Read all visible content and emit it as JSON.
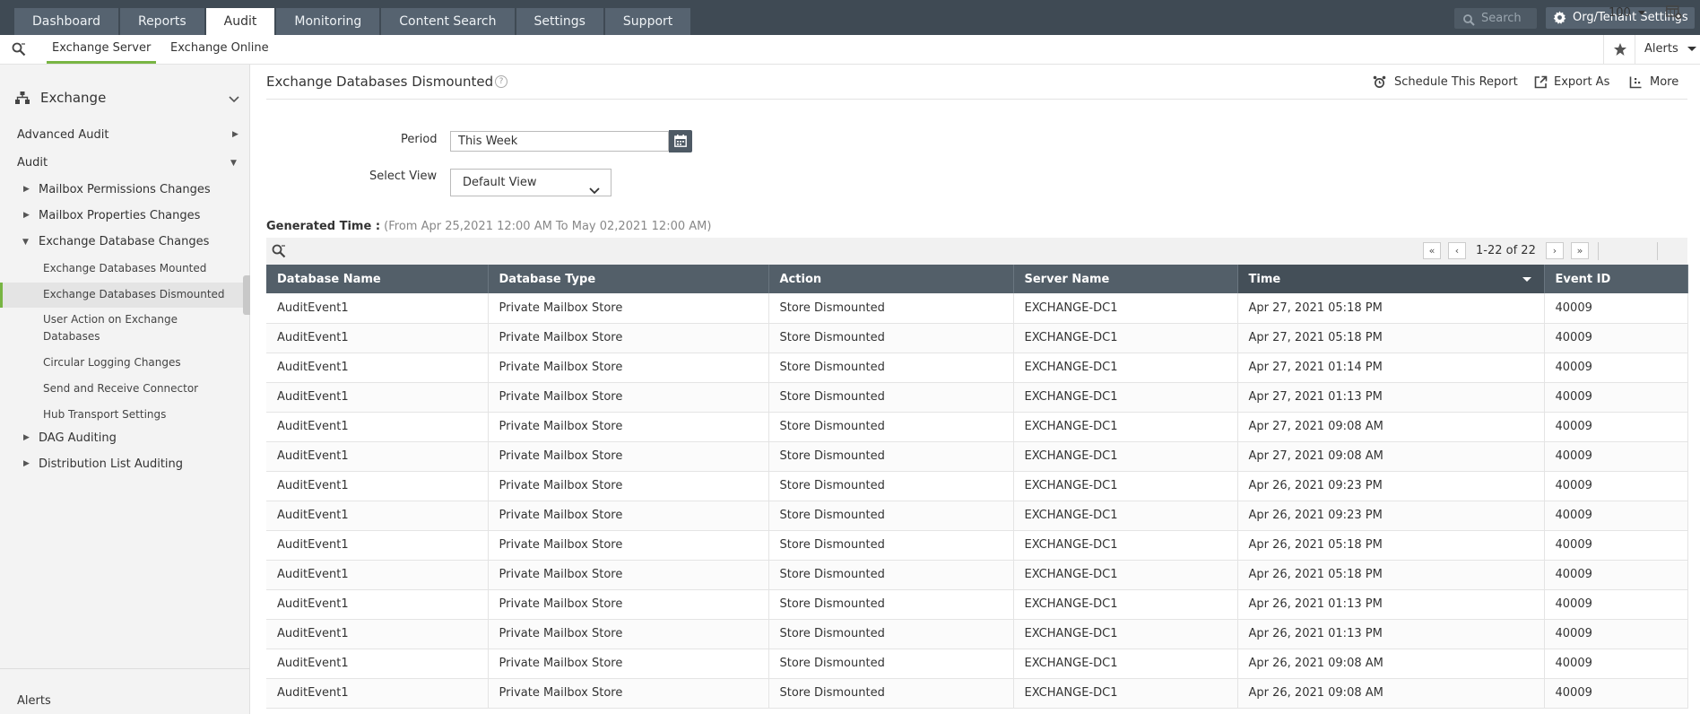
{
  "top_nav": {
    "tabs": [
      {
        "label": "Dashboard"
      },
      {
        "label": "Reports"
      },
      {
        "label": "Audit",
        "active": true
      },
      {
        "label": "Monitoring"
      },
      {
        "label": "Content Search"
      },
      {
        "label": "Settings"
      },
      {
        "label": "Support"
      }
    ],
    "search_placeholder": "Search",
    "org_settings_label": "Org/Tenant Settings"
  },
  "sub_nav": {
    "tabs": [
      {
        "label": "Exchange Server",
        "active": true
      },
      {
        "label": "Exchange Online"
      }
    ],
    "alerts_label": "Alerts"
  },
  "sidebar": {
    "header": "Exchange",
    "sections": [
      {
        "label": "Advanced Audit"
      },
      {
        "label": "Audit"
      }
    ],
    "groups": [
      {
        "label": "Mailbox Permissions Changes"
      },
      {
        "label": "Mailbox Properties Changes"
      },
      {
        "label": "Exchange Database Changes"
      }
    ],
    "sub_items": [
      {
        "label": "Exchange Databases Mounted"
      },
      {
        "label": "Exchange Databases Dismounted",
        "active": true
      },
      {
        "label": "User Action on Exchange Databases"
      },
      {
        "label": "Circular Logging Changes"
      },
      {
        "label": "Send and Receive Connector"
      },
      {
        "label": "Hub Transport Settings"
      }
    ],
    "more_groups": [
      {
        "label": "DAG Auditing"
      },
      {
        "label": "Distribution List Auditing"
      }
    ],
    "bottom_label": "Alerts"
  },
  "report": {
    "title": "Exchange Databases Dismounted",
    "actions": {
      "schedule": "Schedule This Report",
      "export": "Export As",
      "more": "More"
    },
    "period_label": "Period",
    "period_value": "This Week",
    "view_label": "Select View",
    "view_value": "Default View",
    "generated_label": "Generated Time :",
    "generated_range": "(From Apr 25,2021 12:00 AM To May 02,2021 12:00 AM)"
  },
  "pager": {
    "range": "1-22 of 22",
    "page_size": "100"
  },
  "table": {
    "columns": [
      "Database Name",
      "Database Type",
      "Action",
      "Server Name",
      "Time",
      "Event ID"
    ],
    "sorted_column": "Time",
    "rows": [
      [
        "AuditEvent1",
        "Private Mailbox Store",
        "Store Dismounted",
        "EXCHANGE-DC1",
        "Apr 27, 2021 05:18 PM",
        "40009"
      ],
      [
        "AuditEvent1",
        "Private Mailbox Store",
        "Store Dismounted",
        "EXCHANGE-DC1",
        "Apr 27, 2021 05:18 PM",
        "40009"
      ],
      [
        "AuditEvent1",
        "Private Mailbox Store",
        "Store Dismounted",
        "EXCHANGE-DC1",
        "Apr 27, 2021 01:14 PM",
        "40009"
      ],
      [
        "AuditEvent1",
        "Private Mailbox Store",
        "Store Dismounted",
        "EXCHANGE-DC1",
        "Apr 27, 2021 01:13 PM",
        "40009"
      ],
      [
        "AuditEvent1",
        "Private Mailbox Store",
        "Store Dismounted",
        "EXCHANGE-DC1",
        "Apr 27, 2021 09:08 AM",
        "40009"
      ],
      [
        "AuditEvent1",
        "Private Mailbox Store",
        "Store Dismounted",
        "EXCHANGE-DC1",
        "Apr 27, 2021 09:08 AM",
        "40009"
      ],
      [
        "AuditEvent1",
        "Private Mailbox Store",
        "Store Dismounted",
        "EXCHANGE-DC1",
        "Apr 26, 2021 09:23 PM",
        "40009"
      ],
      [
        "AuditEvent1",
        "Private Mailbox Store",
        "Store Dismounted",
        "EXCHANGE-DC1",
        "Apr 26, 2021 09:23 PM",
        "40009"
      ],
      [
        "AuditEvent1",
        "Private Mailbox Store",
        "Store Dismounted",
        "EXCHANGE-DC1",
        "Apr 26, 2021 05:18 PM",
        "40009"
      ],
      [
        "AuditEvent1",
        "Private Mailbox Store",
        "Store Dismounted",
        "EXCHANGE-DC1",
        "Apr 26, 2021 05:18 PM",
        "40009"
      ],
      [
        "AuditEvent1",
        "Private Mailbox Store",
        "Store Dismounted",
        "EXCHANGE-DC1",
        "Apr 26, 2021 01:13 PM",
        "40009"
      ],
      [
        "AuditEvent1",
        "Private Mailbox Store",
        "Store Dismounted",
        "EXCHANGE-DC1",
        "Apr 26, 2021 01:13 PM",
        "40009"
      ],
      [
        "AuditEvent1",
        "Private Mailbox Store",
        "Store Dismounted",
        "EXCHANGE-DC1",
        "Apr 26, 2021 09:08 AM",
        "40009"
      ],
      [
        "AuditEvent1",
        "Private Mailbox Store",
        "Store Dismounted",
        "EXCHANGE-DC1",
        "Apr 26, 2021 09:08 AM",
        "40009"
      ]
    ]
  },
  "colors": {
    "topbar": "#3f4a54",
    "accent_green": "#78b543",
    "table_header": "#535f69"
  },
  "icons": [
    "search-icon",
    "gear-icon",
    "star-icon",
    "tree-icon",
    "chevron-down-icon",
    "help-icon",
    "alarm-clock-icon",
    "export-icon",
    "more-icon",
    "calendar-icon",
    "column-chooser-icon"
  ]
}
